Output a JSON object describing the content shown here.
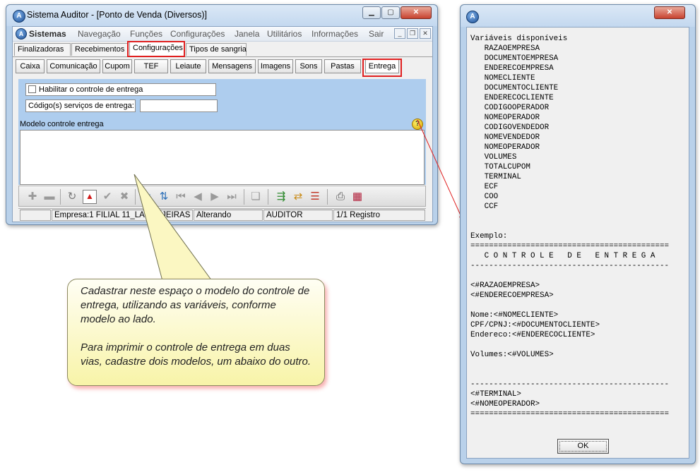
{
  "main_window": {
    "title": "Sistema Auditor - [Ponto de Venda (Diversos)]",
    "app_icon_letter": "A",
    "menu": [
      "Sistemas",
      "Navegação",
      "Funções",
      "Configurações",
      "Janela",
      "Utilitários",
      "Informações",
      "Sair"
    ],
    "tabs": [
      "Finalizadoras",
      "Recebimentos",
      "Configurações",
      "Tipos de sangria"
    ],
    "active_tab": "Configurações",
    "buttons": [
      "Caixa",
      "Comunicação",
      "Cupom",
      "TEF",
      "Leiaute",
      "Mensagens",
      "Imagens",
      "Sons",
      "Pastas",
      "Entrega"
    ],
    "active_button": "Entrega",
    "checkbox_label": "Habilitar o controle de entrega",
    "checkbox_checked": false,
    "codes_label": "Código(s) serviços de entrega:",
    "codes_value": "",
    "modelo_label": "Modelo controle entrega",
    "help_glyph": "?",
    "modelo_value": "",
    "status": [
      "",
      "Empresa:1 FILIAL 11_LARANJEIRAS",
      "Alterando",
      "AUDITOR",
      "1/1 Registro"
    ]
  },
  "toolbar_icons": [
    "add-icon",
    "remove-icon",
    "refresh-icon",
    "warning-icon",
    "confirm-icon",
    "cancel-icon",
    "filter-icon",
    "sort-icon",
    "first-record-icon",
    "previous-record-icon",
    "next-record-icon",
    "last-record-icon",
    "copy-icon",
    "export-icon",
    "import-icon",
    "list-icon",
    "print-icon",
    "report-icon"
  ],
  "callout": {
    "paragraph1": "Cadastrar neste espaço o  modelo do controle de entrega, utilizando as variáveis, conforme modelo ao lado.",
    "paragraph2": "Para imprimir o controle de entrega em duas vias, cadastre dois modelos, um abaixo do outro."
  },
  "dialog": {
    "app_icon_letter": "A",
    "content": "Variáveis disponíveis\n   RAZAOEMPRESA\n   DOCUMENTOEMPRESA\n   ENDERECOEMPRESA\n   NOMECLIENTE\n   DOCUMENTOCLIENTE\n   ENDERECOCLIENTE\n   CODIGOOPERADOR\n   NOMEOPERADOR\n   CODIGOVENDEDOR\n   NOMEVENDEDOR\n   NOMEOPERADOR\n   VOLUMES\n   TOTALCUPOM\n   TERMINAL\n   ECF\n   COO\n   CCF\n\n\nExemplo:\n===========================================\n   C O N T R O L E   D E   E N T R E G A\n-------------------------------------------\n\n<#RAZAOEMPRESA>\n<#ENDERECOEMPRESA>\n\nNome:<#NOMECLIENTE>\nCPF/CPNJ:<#DOCUMENTOCLIENTE>\nEndereco:<#ENDERECOCLIENTE>\n\nVolumes:<#VOLUMES>\n\n\n-------------------------------------------\n<#TERMINAL>\n<#NOMEOPERADOR>\n===========================================",
    "ok_label": "OK"
  },
  "colors": {
    "highlight": "#e02020",
    "panel": "#aecdee",
    "callout": "#f8f4a8",
    "window_frame": "#b9d1ea"
  }
}
